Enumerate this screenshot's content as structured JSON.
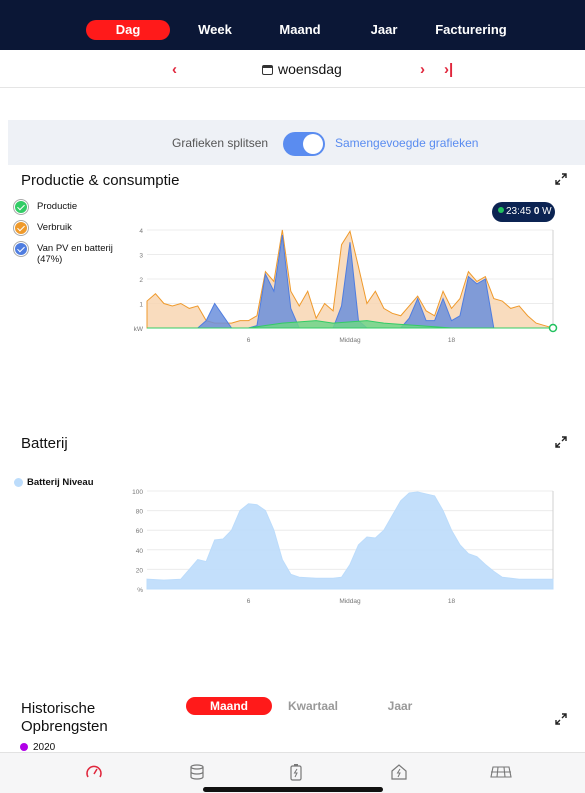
{
  "nav": {
    "tabs": [
      {
        "label": "Dag",
        "active": true
      },
      {
        "label": "Week",
        "active": false
      },
      {
        "label": "Maand",
        "active": false
      },
      {
        "label": "Jaar",
        "active": false
      },
      {
        "label": "Facturering",
        "active": false
      }
    ]
  },
  "datebar": {
    "prev_label": "‹",
    "date_label": "woensdag",
    "next_label": "›",
    "last_label": "›|"
  },
  "toggle": {
    "left_label": "Grafieken splitsen",
    "right_label": "Samengevoegde grafieken",
    "on": true
  },
  "production": {
    "title": "Productie & consumptie",
    "legend": [
      {
        "label": "Productie",
        "color": "#33cc66"
      },
      {
        "label": "Verbruik",
        "color": "#ef9a2c"
      },
      {
        "label": "Van PV en batterij (47%)",
        "color": "#4f7de0"
      }
    ],
    "tooltip_time": "23:45",
    "tooltip_value": "0",
    "tooltip_unit": "W"
  },
  "battery": {
    "title": "Batterij",
    "legend_label": "Batterij Niveau",
    "legend_color": "#bcdcfb"
  },
  "historic": {
    "title_line1": "Historische",
    "title_line2": "Opbrengsten",
    "tabs": [
      {
        "label": "Maand",
        "active": true
      },
      {
        "label": "Kwartaal",
        "active": false
      },
      {
        "label": "Jaar",
        "active": false
      }
    ],
    "legend_label": "2020",
    "legend_color": "#b100e8"
  },
  "bottom_nav": {
    "icons": [
      "gauge-icon",
      "database-icon",
      "battery-icon",
      "house-power-icon",
      "solar-panel-icon"
    ]
  },
  "chart_data": [
    {
      "type": "area",
      "x_unit": "hour",
      "xlim": [
        0,
        24
      ],
      "ylabel": "kW",
      "ylim": [
        0,
        4
      ],
      "yticks": [
        1,
        2,
        3,
        4
      ],
      "xticks": [
        {
          "x": 6,
          "label": "6"
        },
        {
          "x": 12,
          "label": "Middag"
        },
        {
          "x": 18,
          "label": "18"
        }
      ],
      "grid": true,
      "series": [
        {
          "name": "Verbruik",
          "color": "#ef9a2c",
          "fill": "#f8d6b3",
          "x": [
            0,
            0.5,
            1,
            1.5,
            2,
            2.5,
            3,
            3.5,
            4,
            4.5,
            5,
            5.5,
            6,
            6.5,
            7,
            7.5,
            8,
            8.5,
            9,
            9.5,
            10,
            10.5,
            11,
            11.5,
            12,
            12.5,
            13,
            13.5,
            14,
            14.5,
            15,
            15.5,
            16,
            16.5,
            17,
            17.5,
            18,
            18.5,
            19,
            19.5,
            20,
            20.5,
            21,
            21.5,
            22,
            22.5,
            23,
            23.5,
            24
          ],
          "y": [
            1.1,
            1.4,
            1.0,
            0.9,
            1.0,
            0.8,
            0.9,
            0.3,
            0.2,
            0.2,
            0.2,
            0.3,
            0.3,
            0.5,
            2.3,
            1.9,
            4.0,
            1.5,
            0.9,
            1.5,
            0.4,
            1.0,
            0.7,
            3.4,
            3.95,
            2.5,
            1.0,
            1.5,
            0.8,
            0.6,
            0.5,
            0.9,
            1.3,
            0.7,
            0.5,
            1.5,
            0.8,
            1.2,
            2.3,
            1.9,
            2.1,
            1.2,
            1.1,
            0.8,
            0.9,
            0.5,
            0.2,
            0.1,
            0.0
          ]
        },
        {
          "name": "Van PV en batterij",
          "color": "#4f7de0",
          "fill": "#6b8fdc",
          "x": [
            0,
            0.5,
            1,
            1.5,
            2,
            2.5,
            3,
            3.5,
            4,
            4.5,
            5,
            5.5,
            6,
            6.5,
            7,
            7.5,
            8,
            8.5,
            9,
            9.5,
            10,
            10.5,
            11,
            11.5,
            12,
            12.5,
            13,
            13.5,
            14,
            14.5,
            15,
            15.5,
            16,
            16.5,
            17,
            17.5,
            18,
            18.5,
            19,
            19.5,
            20,
            20.5,
            21,
            21.5,
            22,
            22.5,
            23,
            23.5,
            24
          ],
          "y": [
            0.0,
            0.0,
            0.0,
            0.0,
            0.0,
            0.0,
            0.0,
            0.3,
            1.0,
            0.5,
            0.0,
            0.0,
            0.0,
            0.1,
            2.2,
            1.5,
            3.8,
            0.8,
            0.0,
            0.0,
            0.0,
            0.0,
            0.0,
            0.9,
            3.5,
            0.3,
            0.0,
            0.0,
            0.0,
            0.0,
            0.0,
            0.4,
            1.2,
            0.3,
            0.3,
            1.2,
            0.3,
            0.5,
            2.1,
            1.8,
            2.0,
            0.0,
            0.0,
            0.0,
            0.0,
            0.0,
            0.0,
            0.0,
            0.0
          ]
        },
        {
          "name": "Productie",
          "color": "#33cc66",
          "fill": "#6fd58a",
          "x": [
            0,
            6,
            7,
            8,
            9,
            10,
            11,
            12,
            13,
            14,
            15,
            16,
            17,
            18,
            19,
            24
          ],
          "y": [
            0,
            0,
            0.1,
            0.2,
            0.25,
            0.3,
            0.2,
            0.25,
            0.3,
            0.2,
            0.15,
            0.1,
            0.05,
            0,
            0,
            0
          ]
        }
      ]
    },
    {
      "type": "area",
      "x_unit": "hour",
      "xlim": [
        0,
        24
      ],
      "ylabel": "%",
      "ylim": [
        0,
        100
      ],
      "yticks": [
        20,
        40,
        60,
        80,
        100
      ],
      "xticks": [
        {
          "x": 6,
          "label": "6"
        },
        {
          "x": 12,
          "label": "Middag"
        },
        {
          "x": 18,
          "label": "18"
        }
      ],
      "grid": true,
      "series": [
        {
          "name": "Batterij Niveau",
          "color": "#bcdcfb",
          "x": [
            0,
            1,
            2,
            2.5,
            3,
            3.5,
            4,
            4.5,
            5,
            5.5,
            6,
            6.5,
            7,
            7.5,
            8,
            8.5,
            9,
            10,
            11,
            11.5,
            12,
            12.5,
            13,
            13.5,
            14,
            14.5,
            15,
            15.5,
            16,
            16.5,
            17,
            17.5,
            18,
            18.5,
            19,
            19.5,
            20,
            20.5,
            21,
            22,
            23,
            24
          ],
          "y": [
            10,
            9,
            10,
            20,
            30,
            28,
            50,
            51,
            60,
            80,
            87,
            86,
            80,
            60,
            30,
            15,
            12,
            11,
            11,
            12,
            25,
            45,
            53,
            52,
            60,
            75,
            90,
            98,
            99,
            97,
            95,
            80,
            60,
            45,
            36,
            33,
            25,
            18,
            12,
            10,
            10,
            10
          ]
        }
      ]
    }
  ]
}
